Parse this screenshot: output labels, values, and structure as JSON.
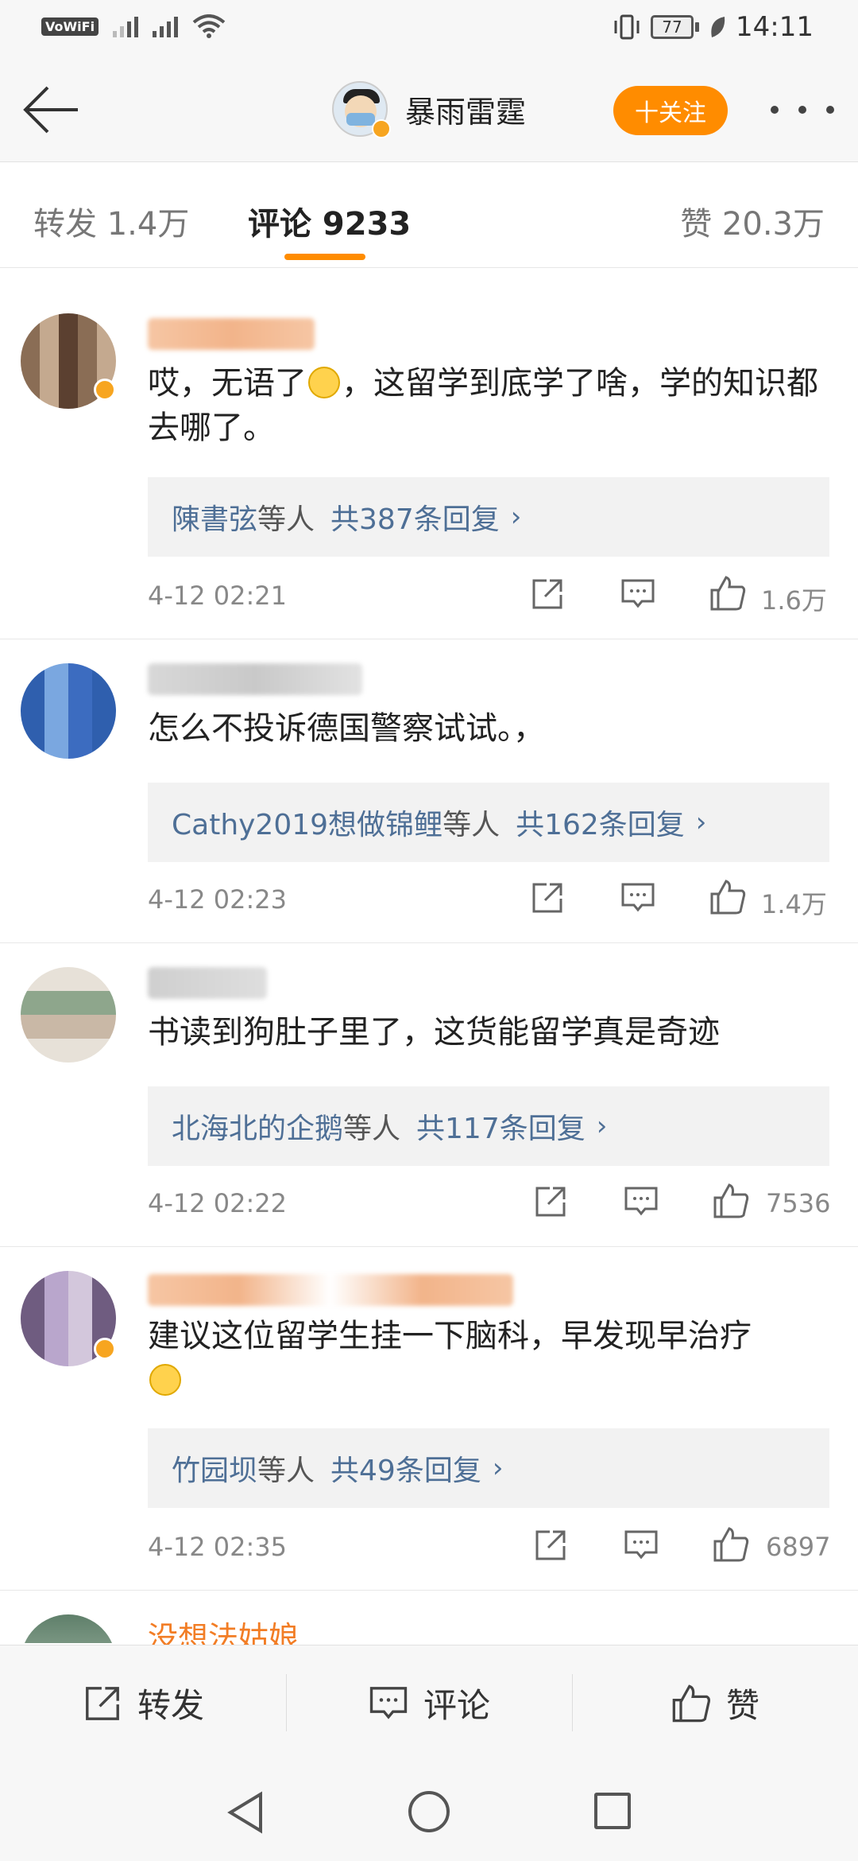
{
  "status_bar": {
    "vowifi": "VoWiFi",
    "battery": "77",
    "time": "14:11"
  },
  "header": {
    "name": "暴雨雷霆",
    "follow_label": "十关注"
  },
  "tabs": {
    "repost": "转发 1.4万",
    "comments": "评论 9233",
    "likes": "赞 20.3万"
  },
  "comments": [
    {
      "text": "哎，无语了",
      "text_after_emoji": "，这留学到底学了啥，学的知识都去哪了。",
      "emoji": "sad-sweat-face",
      "reply": {
        "names": "陳書弦",
        "suffix": "等人",
        "count": "共387条回复"
      },
      "time": "4-12 02:21",
      "likes": "1.6万"
    },
    {
      "text": "怎么不投诉德国警察试试。，",
      "reply": {
        "names": "Cathy2019想做锦鲤",
        "suffix": "等人",
        "count": "共162条回复"
      },
      "time": "4-12 02:23",
      "likes": "1.4万"
    },
    {
      "text": "书读到狗肚子里了，这货能留学真是奇迹",
      "reply": {
        "names": "北海北的企鹅",
        "suffix": "等人",
        "count": "共117条回复"
      },
      "time": "4-12 02:22",
      "likes": "7536"
    },
    {
      "text": "建议这位留学生挂一下脑科，早发现早治疗",
      "emoji": "shush-face",
      "reply": {
        "names": "竹园坝",
        "suffix": "等人",
        "count": "共49条回复"
      },
      "time": "4-12 02:35",
      "likes": "6897"
    }
  ],
  "next_comment": {
    "name": "没想法姑娘"
  },
  "bottom_bar": {
    "repost": "转发",
    "comment": "评论",
    "like": "赞"
  },
  "colors": {
    "accent": "#ff8c00",
    "link": "#4e6f96",
    "username_orange": "#f27d25"
  }
}
